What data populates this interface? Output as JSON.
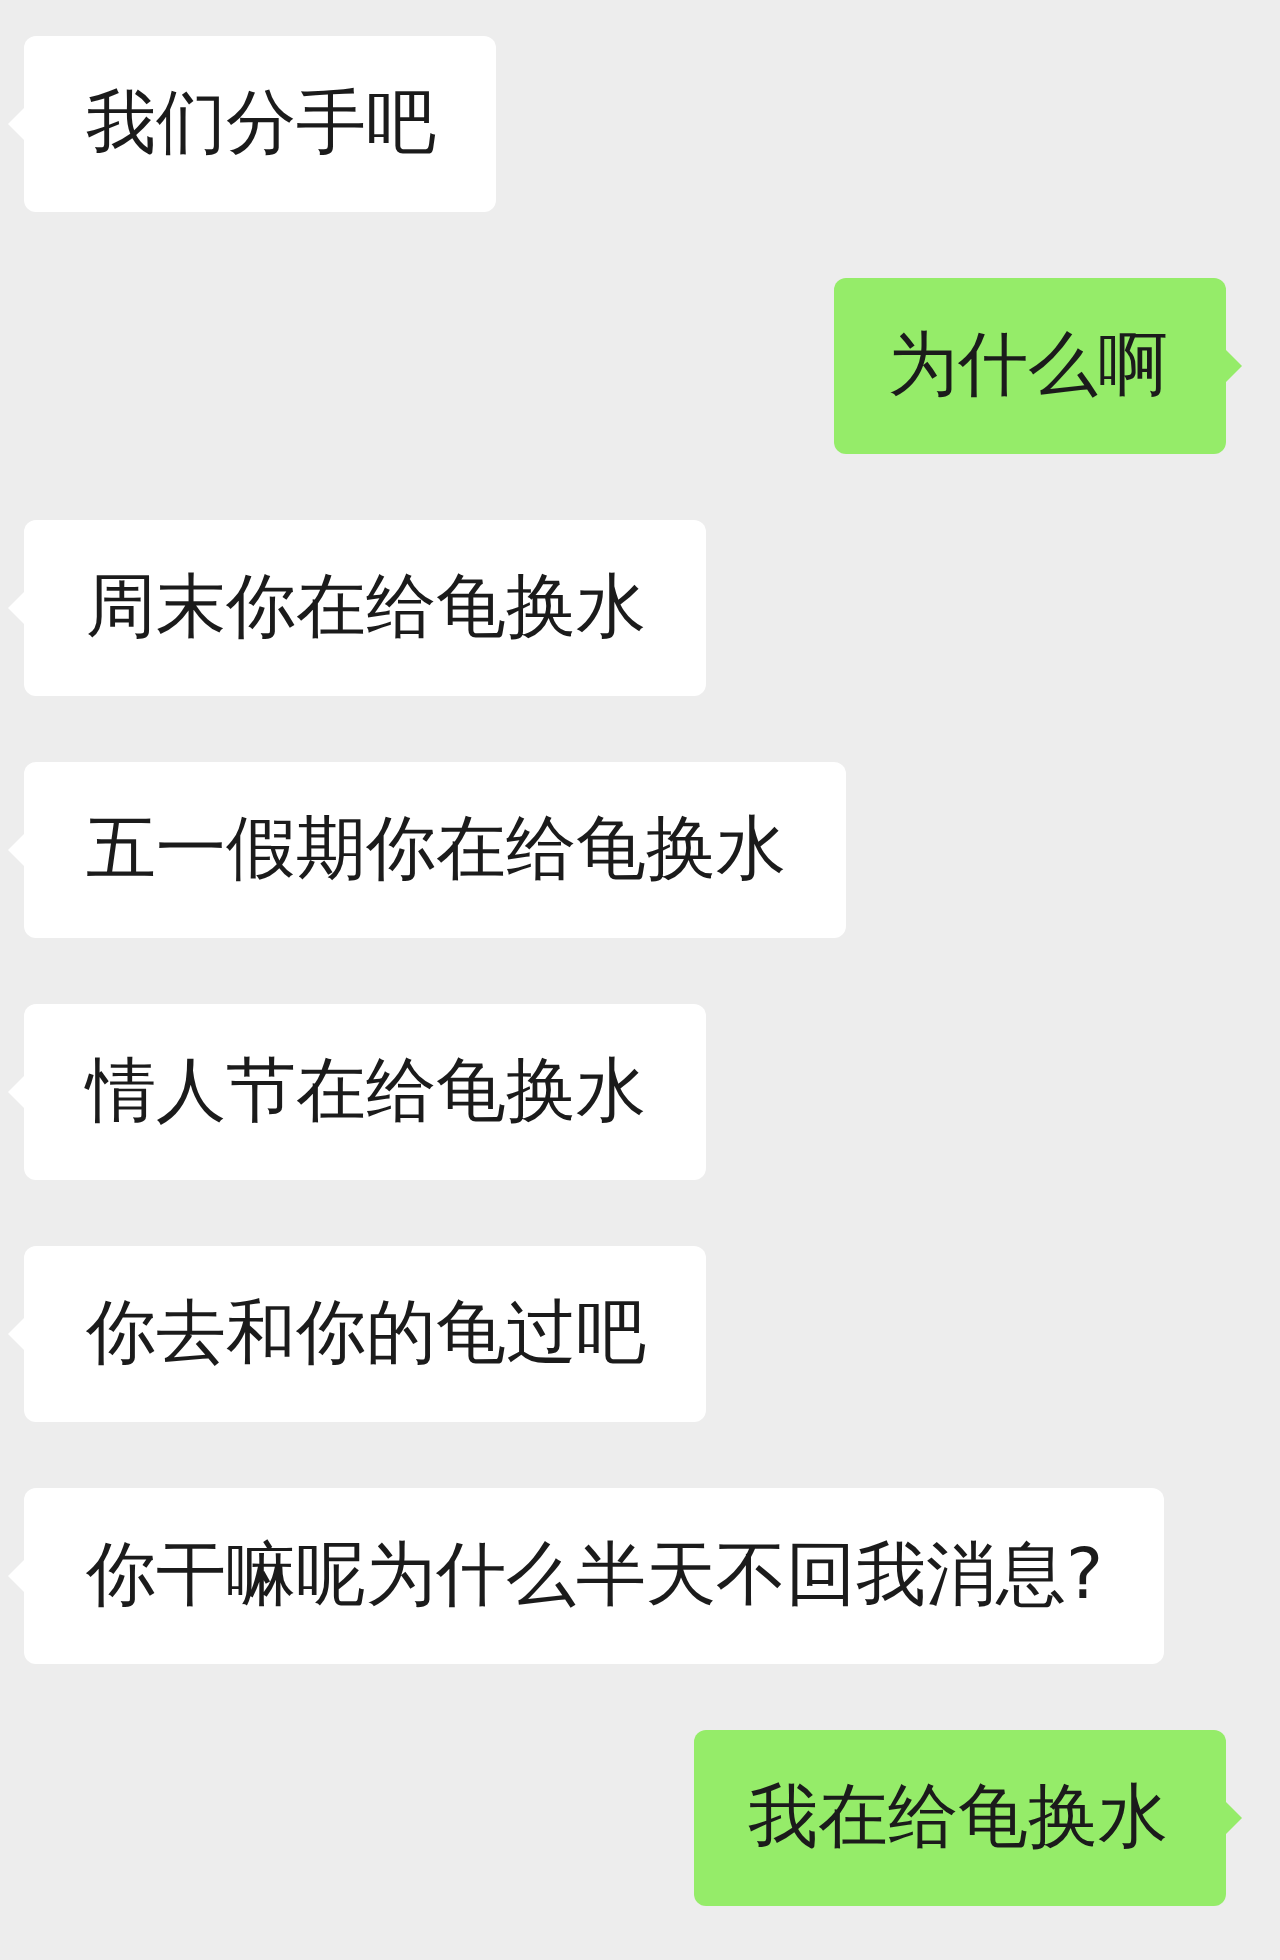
{
  "messages": [
    {
      "kind": "received",
      "text": "我们分手吧"
    },
    {
      "kind": "sent",
      "text": "为什么啊"
    },
    {
      "kind": "received",
      "text": "周末你在给龟换水"
    },
    {
      "kind": "received",
      "text": "五一假期你在给龟换水"
    },
    {
      "kind": "received",
      "text": "情人节在给龟换水"
    },
    {
      "kind": "received",
      "text": "你去和你的龟过吧"
    },
    {
      "kind": "received",
      "text": "你干嘛呢为什么半天不回我消息?"
    },
    {
      "kind": "sent",
      "text": "我在给龟换水"
    }
  ]
}
